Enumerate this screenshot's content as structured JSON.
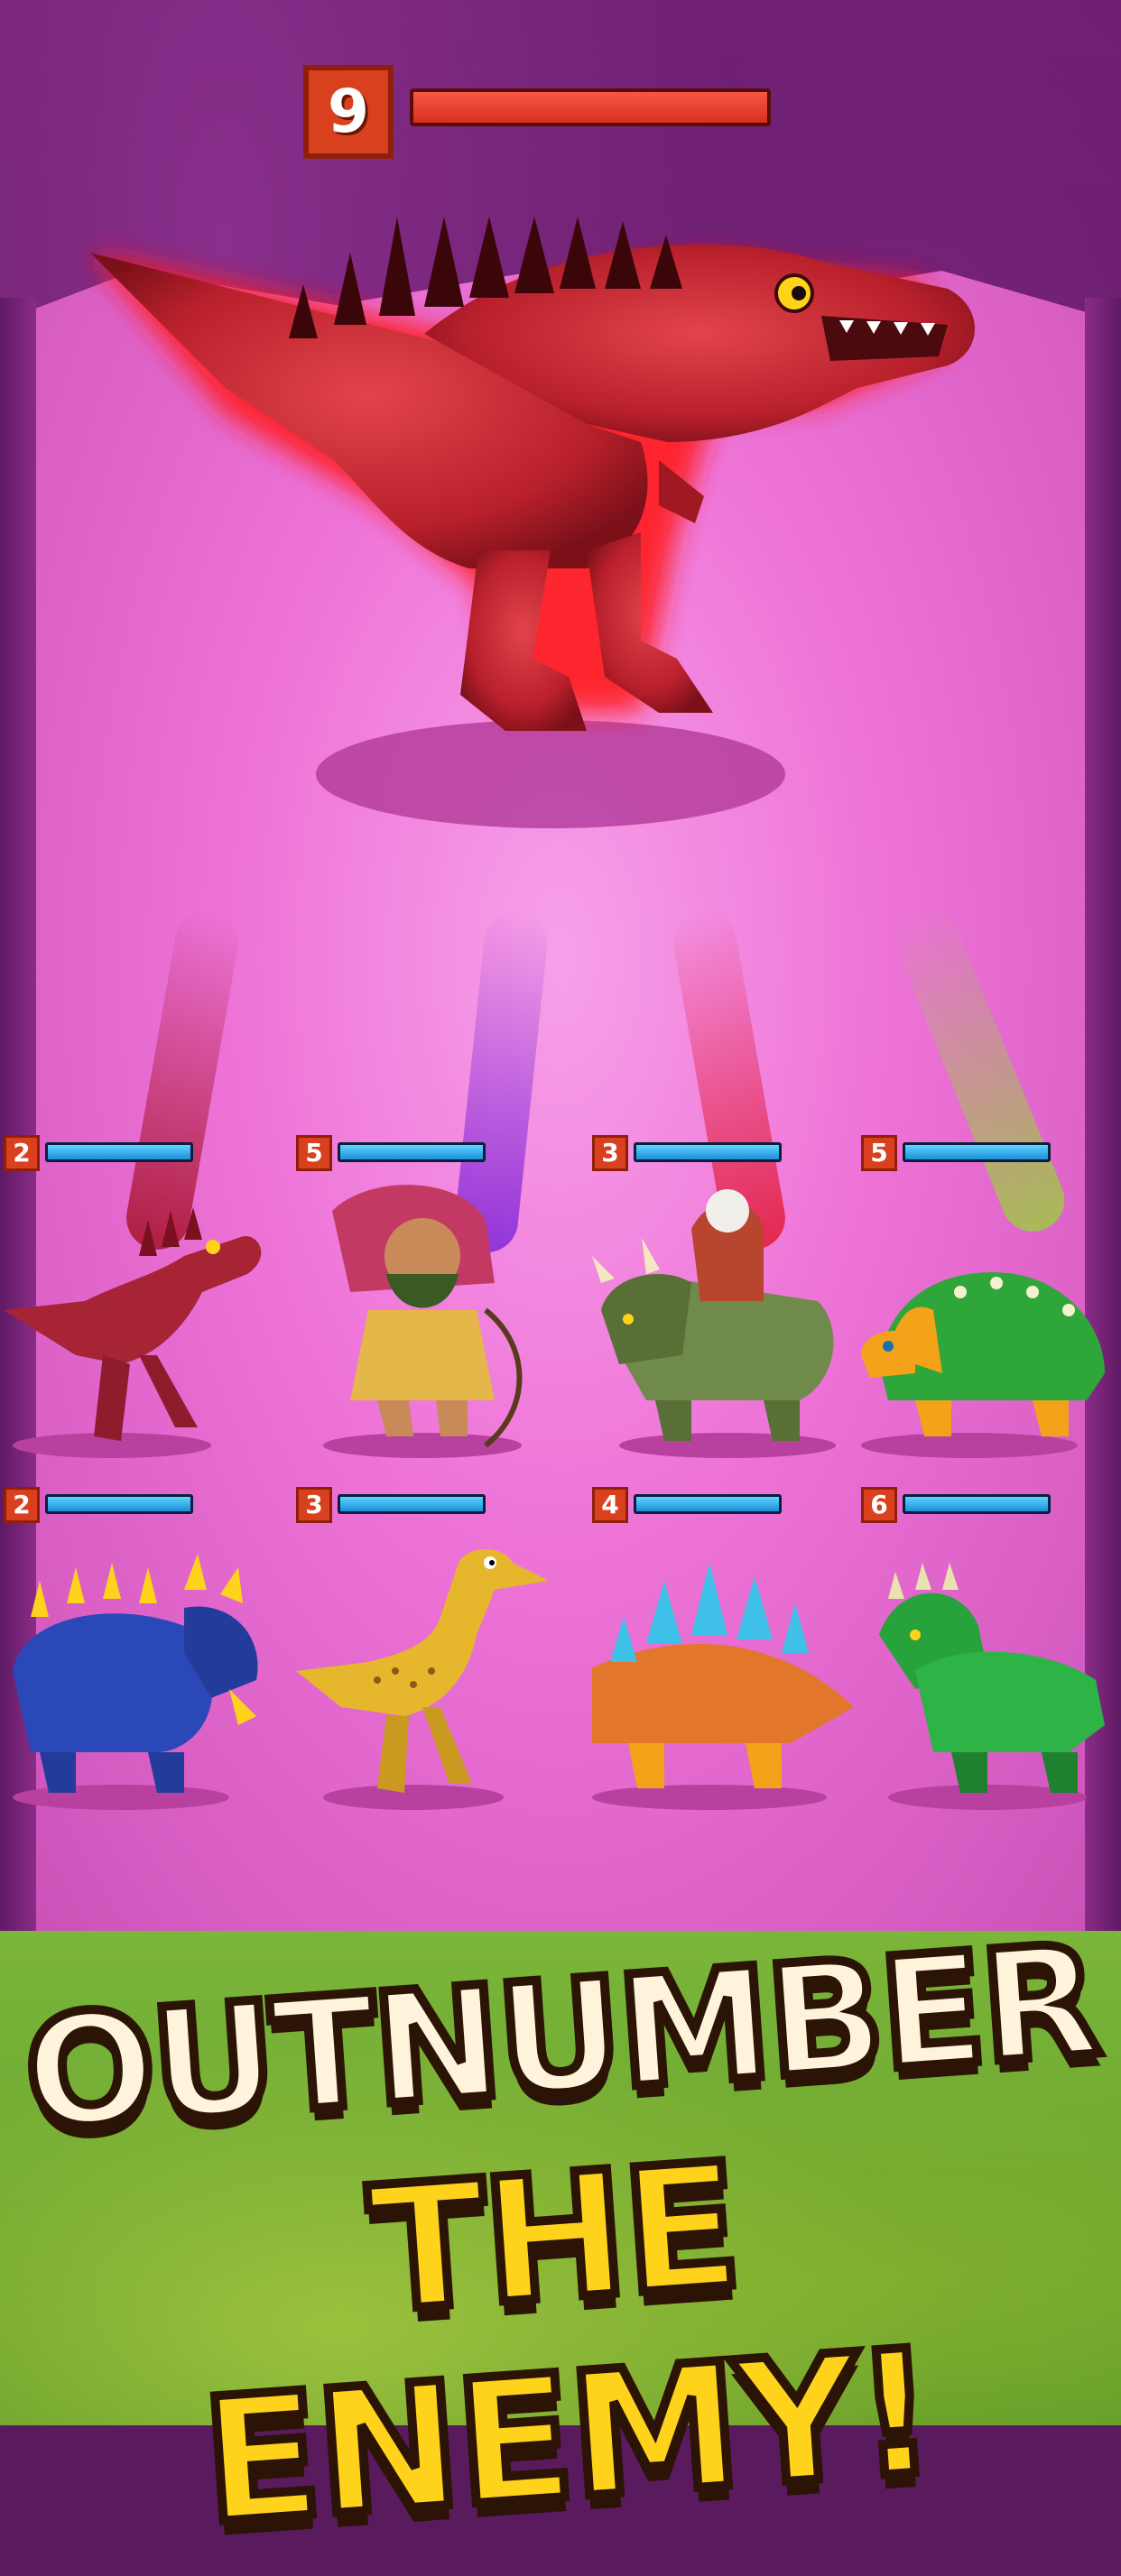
{
  "boss": {
    "level": "9",
    "health_fraction": 1.0,
    "name_icon": "red-allosaurus"
  },
  "units": [
    {
      "level": "2",
      "health_fraction": 1.0,
      "icon": "red-raptor"
    },
    {
      "level": "5",
      "health_fraction": 1.0,
      "icon": "caveman-archer"
    },
    {
      "level": "3",
      "health_fraction": 1.0,
      "icon": "triceratops-caveman-rider"
    },
    {
      "level": "5",
      "health_fraction": 1.0,
      "icon": "green-ankylosaurus"
    },
    {
      "level": "2",
      "health_fraction": 1.0,
      "icon": "blue-styracosaurus"
    },
    {
      "level": "3",
      "health_fraction": 1.0,
      "icon": "yellow-gallimimus"
    },
    {
      "level": "4",
      "health_fraction": 1.0,
      "icon": "orange-stegosaurus"
    },
    {
      "level": "6",
      "health_fraction": 1.0,
      "icon": "green-styracosaurus"
    }
  ],
  "banner": {
    "line1": "OUTNUMBER",
    "line2": "THE ENEMY!"
  },
  "colors": {
    "arena_pink": "#ee74d8",
    "cave_purple": "#5a1a5e",
    "level_badge": "#d9401d",
    "boss_bar": "#e23b26",
    "unit_bar": "#2aa6e8",
    "banner_white": "#fff3dc",
    "banner_yellow": "#ffd21c"
  }
}
